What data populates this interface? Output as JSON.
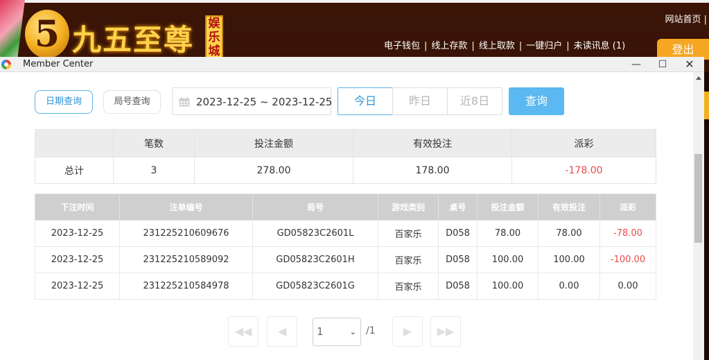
{
  "site": {
    "logo_number": "5",
    "logo_title": "九五至尊",
    "logo_side": "娱乐城",
    "top_link": "网站首页 |",
    "nav": [
      "电子钱包",
      "线上存款",
      "线上取款",
      "一键归户",
      "未读讯息 (1)"
    ],
    "logout": "登出"
  },
  "window": {
    "title": "Member Center",
    "minimize": "—",
    "maximize": "☐",
    "close": "✕"
  },
  "filters": {
    "tab_date": "日期查询",
    "tab_round": "局号查询",
    "date_range": "2023-12-25 ~ 2023-12-25",
    "quick_today": "今日",
    "quick_yesterday": "昨日",
    "quick_8days": "近8日",
    "query": "查询"
  },
  "summary": {
    "headers": [
      "",
      "笔数",
      "投注金额",
      "有效投注",
      "派彩"
    ],
    "row": [
      "总计",
      "3",
      "278.00",
      "178.00",
      "-178.00"
    ]
  },
  "detail": {
    "headers": [
      "下注时间",
      "注单编号",
      "局号",
      "游戏类别",
      "桌号",
      "投注金额",
      "有效投注",
      "派彩"
    ],
    "rows": [
      [
        "2023-12-25",
        "231225210609676",
        "GD05823C2601L",
        "百家乐",
        "D058",
        "78.00",
        "78.00",
        "-78.00"
      ],
      [
        "2023-12-25",
        "231225210589092",
        "GD05823C2601H",
        "百家乐",
        "D058",
        "100.00",
        "100.00",
        "-100.00"
      ],
      [
        "2023-12-25",
        "231225210584978",
        "GD05823C2601G",
        "百家乐",
        "D058",
        "100.00",
        "0.00",
        "0.00"
      ]
    ]
  },
  "pagination": {
    "first": "◀◀",
    "prev": "◀",
    "next": "▶",
    "last": "▶▶",
    "current": "1",
    "total": "/1"
  },
  "colors": {
    "accent": "#5bb8f0",
    "negative": "#e84b4b",
    "brand_gold": "#ffd24a"
  }
}
